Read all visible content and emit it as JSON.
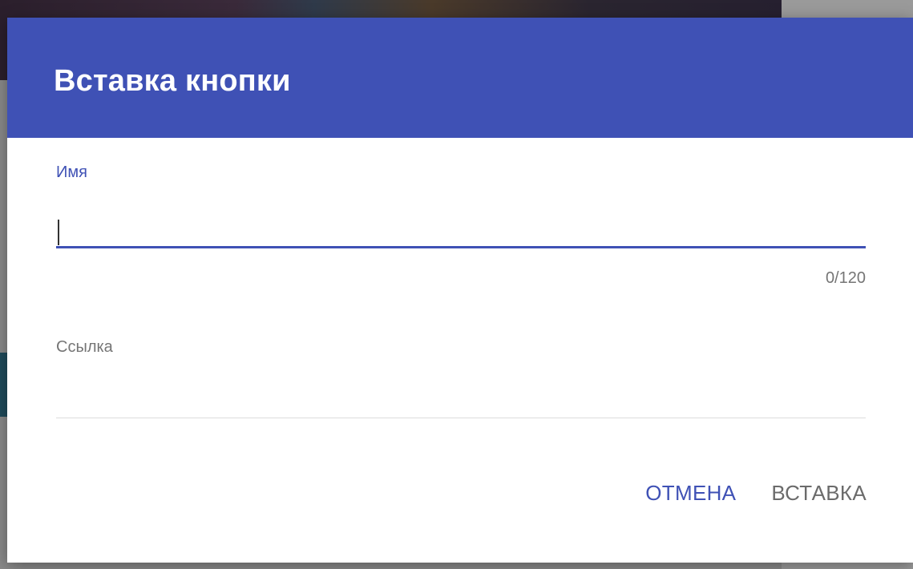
{
  "dialog": {
    "title": "Вставка кнопки",
    "accent_color": "#3f51b5"
  },
  "fields": {
    "name": {
      "label": "Имя",
      "value": "",
      "counter": "0/120"
    },
    "link": {
      "label": "Ссылка",
      "value": ""
    }
  },
  "actions": {
    "cancel_label": "ОТМЕНА",
    "insert_label": "ВСТАВКА"
  }
}
